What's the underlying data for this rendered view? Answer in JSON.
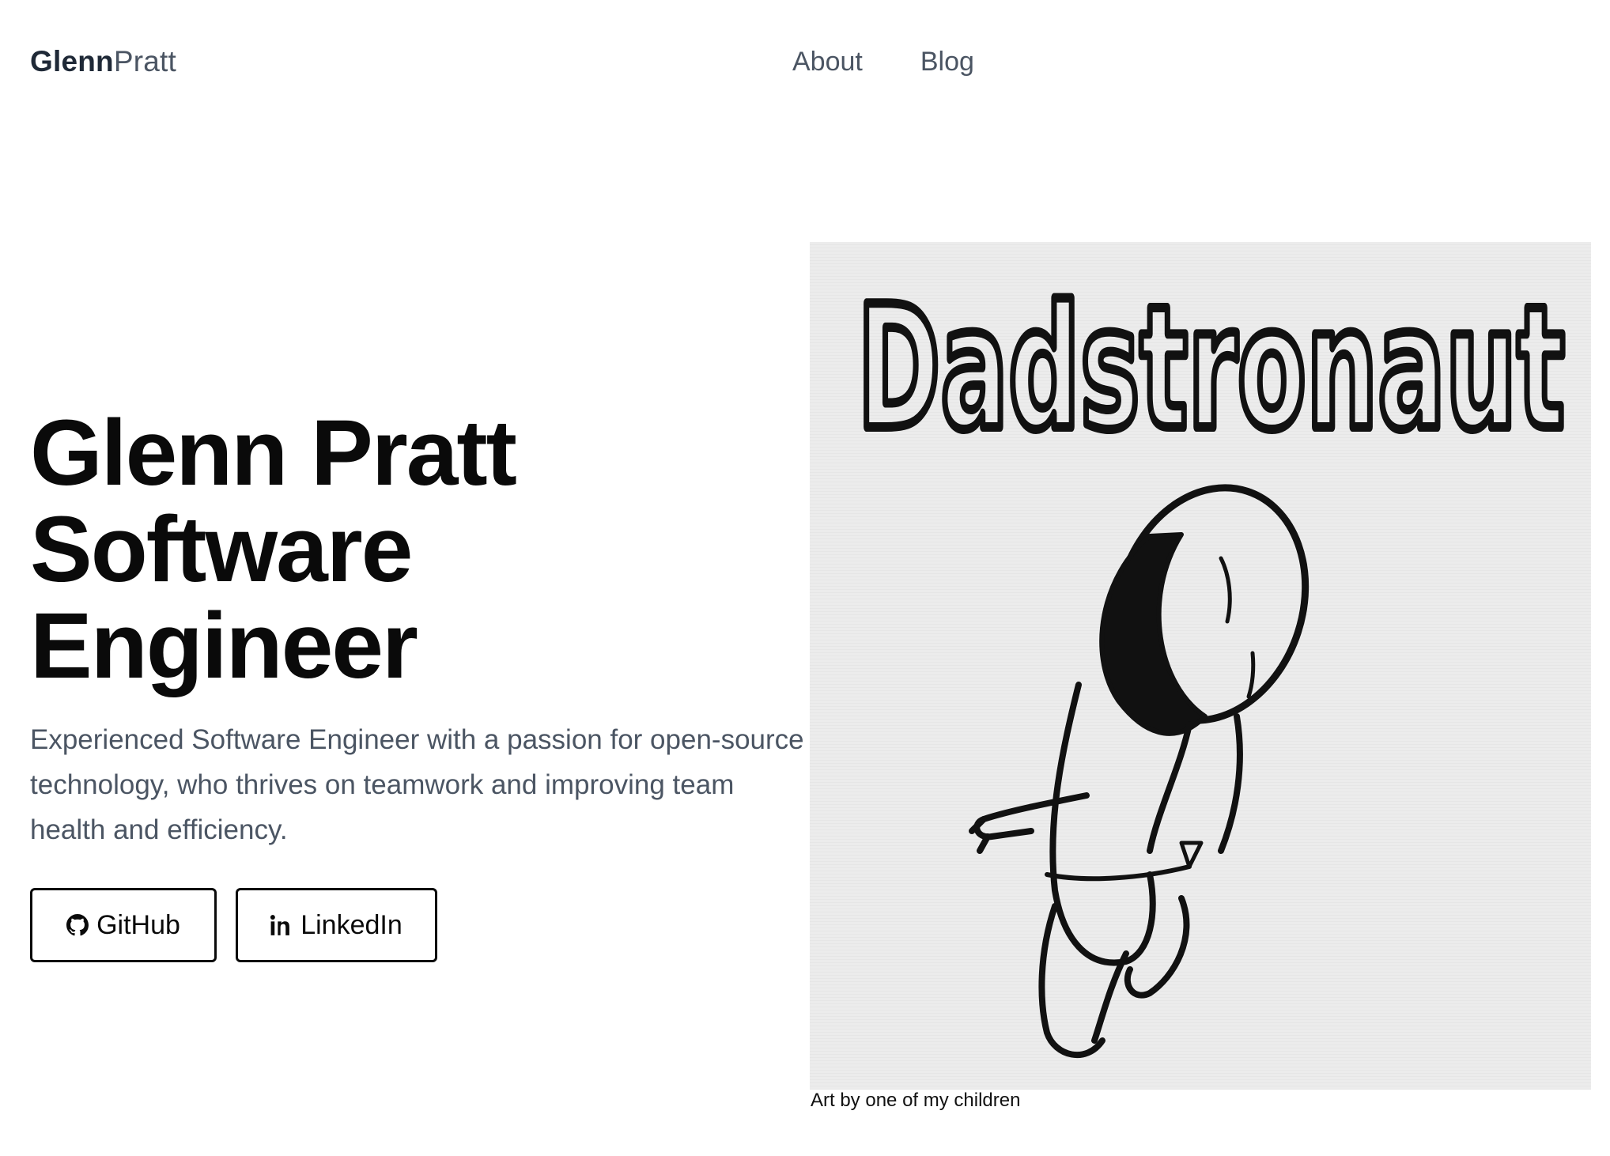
{
  "header": {
    "brand_first": "Glenn",
    "brand_last": "Pratt",
    "nav": [
      {
        "label": "About"
      },
      {
        "label": "Blog"
      }
    ]
  },
  "hero": {
    "title_lines": [
      "Glenn Pratt",
      "Software",
      "Engineer"
    ],
    "description": "Experienced Software Engineer with a passion for open-source technology, who thrives on teamwork and improving team health and efficiency.",
    "buttons": [
      {
        "label": "GitHub",
        "icon": "github-icon"
      },
      {
        "label": "LinkedIn",
        "icon": "linkedin-icon"
      }
    ]
  },
  "art": {
    "drawn_text": "Dadstronaut",
    "caption": "Art by one of my children"
  }
}
